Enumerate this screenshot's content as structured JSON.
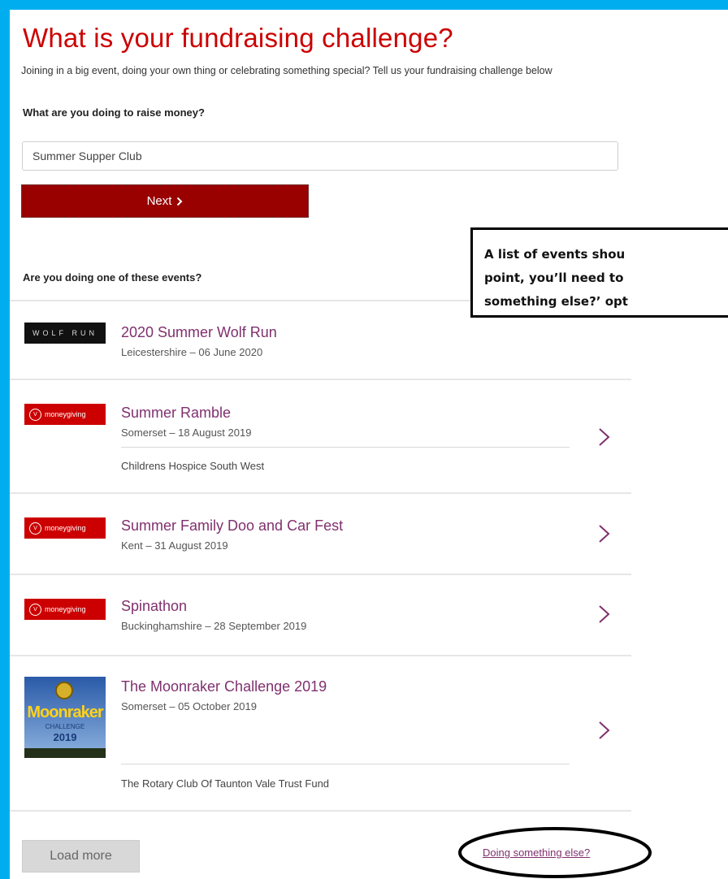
{
  "heading": "What is your fundraising challenge?",
  "intro": "Joining in a big event, doing your own thing or celebrating something special? Tell us your fundraising challenge below",
  "question_label": "What are you doing to raise money?",
  "question_input": {
    "value": "Summer Supper Club"
  },
  "next_button": {
    "label": "Next",
    "icon": "chevron-right-icon"
  },
  "events_label": "Are you doing one of these events?",
  "callout": {
    "line1": "A list of events shou",
    "line2": "point, you’ll need to",
    "line3": "something else?’ opt"
  },
  "events": [
    {
      "logo": "WOLF RUN",
      "name": "2020 Summer Wolf Run",
      "meta": "Leicestershire – 06 June 2020"
    },
    {
      "logo": "moneygiving",
      "name": "Summer Ramble",
      "meta": "Somerset – 18 August 2019",
      "charity": "Childrens Hospice South West"
    },
    {
      "logo": "moneygiving",
      "name": "Summer Family Doo and Car Fest",
      "meta": "Kent – 31 August 2019"
    },
    {
      "logo": "moneygiving",
      "name": "Spinathon",
      "meta": "Buckinghamshire – 28 September 2019"
    },
    {
      "logo_title": "Moonraker",
      "logo_sub": "CHALLENGE",
      "logo_year": "2019",
      "name": "The Moonraker Challenge 2019",
      "meta": "Somerset – 05 October 2019",
      "charity": "The Rotary Club Of Taunton Vale Trust Fund"
    }
  ],
  "load_more": "Load more",
  "doing_something_else": "Doing something else?",
  "colors": {
    "page_frame": "#00aeef",
    "heading": "#cc0000",
    "next_bg": "#990000",
    "event_name": "#80306e"
  }
}
